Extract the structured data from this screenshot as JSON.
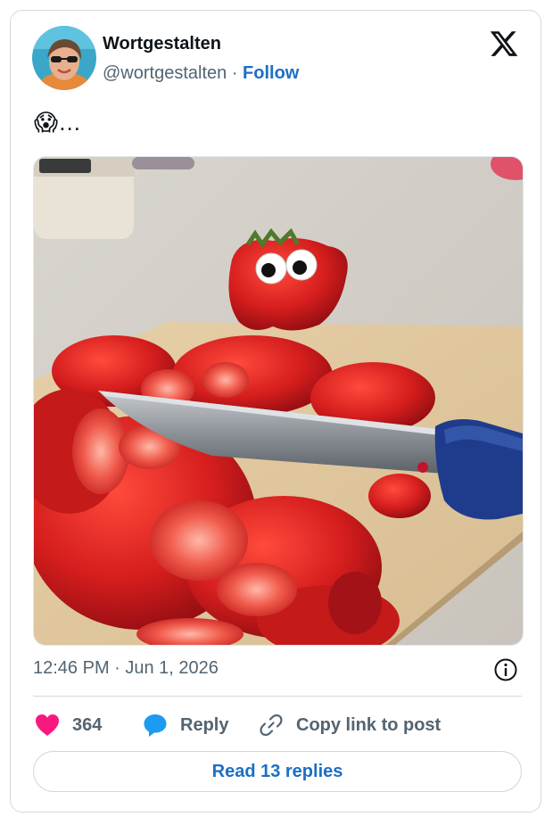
{
  "author": {
    "name": "Wortgestalten",
    "handle": "@wortgestalten",
    "separator": " · ",
    "follow_label": "Follow"
  },
  "tweet": {
    "text": "😱…",
    "image_alt": "Cut strawberries on a cutting board with a knife; a strawberry with googly eyes sits in the background"
  },
  "meta": {
    "timestamp": "12:46 PM · Jun 1, 2026"
  },
  "actions": {
    "like_count": "364",
    "reply_label": "Reply",
    "copy_label": "Copy link to post"
  },
  "read_replies_label": "Read 13 replies",
  "icons": {
    "brand": "x-logo-icon",
    "info": "info-icon",
    "like": "heart-icon",
    "reply": "speech-bubble-icon",
    "copy": "link-icon"
  },
  "colors": {
    "like": "#f91880",
    "reply_icon": "#1d9bf0",
    "link": "#1d6fc4",
    "secondary_text": "#536471",
    "border": "#cfd9de"
  }
}
